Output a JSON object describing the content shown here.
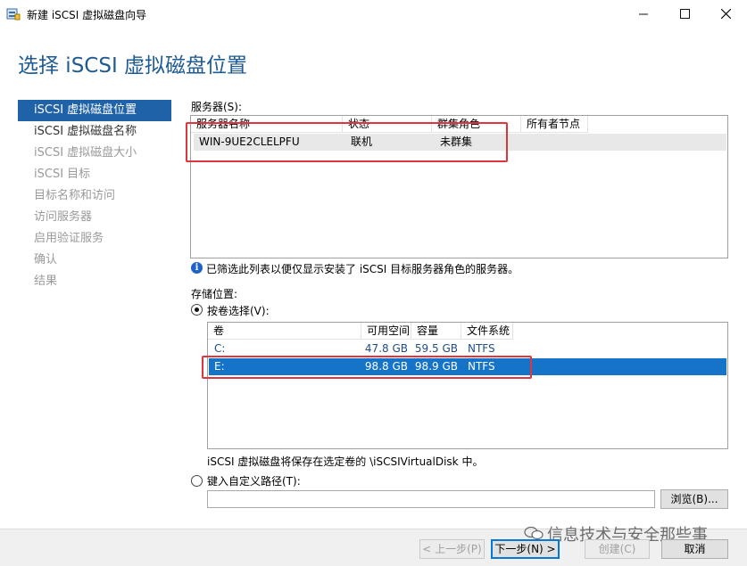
{
  "window": {
    "title": "新建 iSCSI 虚拟磁盘向导",
    "minimize_icon": "minimize-icon",
    "maximize_icon": "maximize-icon",
    "close_icon": "close-icon"
  },
  "heading": "选择 iSCSI 虚拟磁盘位置",
  "nav": {
    "items": [
      {
        "label": "iSCSI 虚拟磁盘位置",
        "state": "active"
      },
      {
        "label": "iSCSI 虚拟磁盘名称",
        "state": "enabled"
      },
      {
        "label": "iSCSI 虚拟磁盘大小",
        "state": "disabled"
      },
      {
        "label": "iSCSI 目标",
        "state": "disabled"
      },
      {
        "label": "目标名称和访问",
        "state": "disabled"
      },
      {
        "label": "访问服务器",
        "state": "disabled"
      },
      {
        "label": "启用验证服务",
        "state": "disabled"
      },
      {
        "label": "确认",
        "state": "disabled"
      },
      {
        "label": "结果",
        "state": "disabled"
      }
    ]
  },
  "servers": {
    "label": "服务器(S):",
    "columns": [
      "服务器名称",
      "状态",
      "群集角色",
      "所有者节点"
    ],
    "rows": [
      {
        "name": "WIN-9UE2CLELPFU",
        "status": "联机",
        "cluster_role": "未群集",
        "owner": ""
      }
    ]
  },
  "info_text": "已筛选此列表以便仅显示安装了 iSCSI 目标服务器角色的服务器。",
  "storage": {
    "label": "存储位置:",
    "by_volume_label": "按卷选择(V):",
    "by_volume_selected": true,
    "columns": [
      "卷",
      "可用空间",
      "容量",
      "文件系统"
    ],
    "rows": [
      {
        "volume": "C:",
        "free": "47.8 GB",
        "capacity": "59.5 GB",
        "fs": "NTFS",
        "selected": false
      },
      {
        "volume": "E:",
        "free": "98.8 GB",
        "capacity": "98.9 GB",
        "fs": "NTFS",
        "selected": true
      }
    ],
    "save_note": "iSCSI 虚拟磁盘将保存在选定卷的 \\iSCSIVirtualDisk 中。",
    "custom_path_label": "键入自定义路径(T):",
    "custom_path_value": "",
    "browse_label": "浏览(B)..."
  },
  "buttons": {
    "prev": "< 上一步(P)",
    "next": "下一步(N) >",
    "create": "创建(C)",
    "cancel": "取消"
  },
  "watermark": "信息技术与安全那些事",
  "colors": {
    "heading": "#1f5b93",
    "nav_active": "#1f62a8",
    "row_selected": "#1573c8",
    "highlight_box": "#e0353e"
  }
}
